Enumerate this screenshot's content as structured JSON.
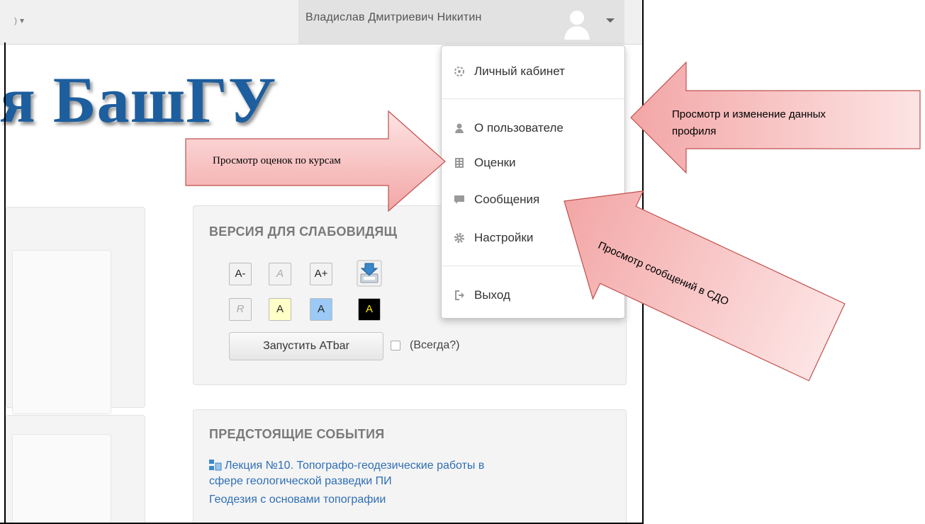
{
  "navbar": {
    "user_name": "Владислав Дмитриевич Никитин"
  },
  "logo": {
    "text": "я БашГУ"
  },
  "user_menu": {
    "items": [
      {
        "label": "Личный кабинет",
        "icon": "dashboard-icon"
      },
      {
        "label": "О пользователе",
        "icon": "user-icon"
      },
      {
        "label": "Оценки",
        "icon": "grades-icon"
      },
      {
        "label": "Сообщения",
        "icon": "message-icon"
      },
      {
        "label": "Настройки",
        "icon": "gear-icon"
      },
      {
        "label": "Выход",
        "icon": "logout-icon"
      }
    ]
  },
  "accessibility": {
    "title": "ВЕРСИЯ ДЛЯ СЛАБОВИДЯЩ",
    "font_buttons": [
      "A-",
      "A",
      "A+"
    ],
    "color_buttons": [
      "R",
      "A",
      "A",
      "A"
    ],
    "run_button": "Запустить ATbar",
    "always_label": "(Всегда?)"
  },
  "events": {
    "title": "ПРЕДСТОЯЩИЕ СОБЫТИЯ",
    "event_line1": "Лекция №10. Топографо-геодезические работы в",
    "event_line2": "сфере геологической разведки ПИ",
    "course": "Геодезия с основами топографии"
  },
  "annotations": {
    "grades": "Просмотр оценок по курсам",
    "profile_line1": "Просмотр и изменение данных",
    "profile_line2": "профиля",
    "messages": "Просмотр сообщений в СДО"
  },
  "colors": {
    "logo": "#1d5e9e",
    "link": "#2f6eb5",
    "arrow_fill_top": "#fde4e4",
    "arrow_fill_bottom": "#f3a6a6",
    "arrow_stroke": "#c0504d"
  }
}
